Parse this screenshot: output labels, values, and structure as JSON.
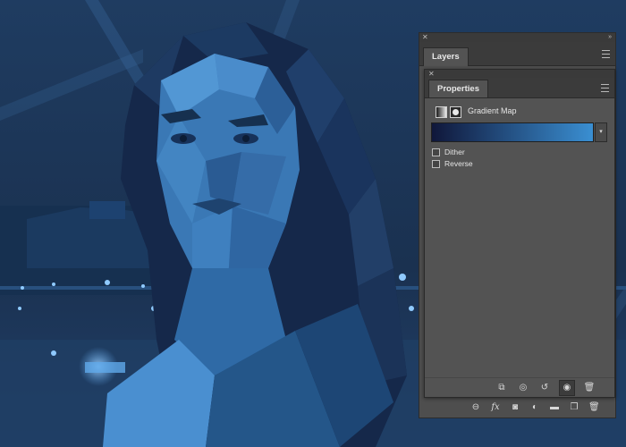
{
  "layers_panel": {
    "tab_label": "Layers",
    "close_icon": "close-x-icon",
    "collapse_icon": "double-chevron-icon",
    "menu_icon": "panel-menu-icon",
    "footer_icons": [
      "link-layers-icon",
      "fx-icon",
      "add-mask-icon",
      "adjustment-layer-icon",
      "group-folder-icon",
      "new-layer-icon",
      "trash-icon"
    ],
    "fx_label": "fx"
  },
  "properties_panel": {
    "tab_label": "Properties",
    "title": "Gradient Map",
    "gradient": {
      "start_color": "#10173a",
      "end_color": "#3a8fd2"
    },
    "options": [
      {
        "label": "Dither",
        "checked": false
      },
      {
        "label": "Reverse",
        "checked": false
      }
    ],
    "footer_icons": [
      "clip-to-layer-icon",
      "view-previous-state-icon",
      "reset-icon",
      "visibility-eye-icon",
      "trash-icon"
    ],
    "visibility_toggle_active": true
  },
  "colors": {
    "canvas_background": "#1b3352",
    "panel_background": "#535353",
    "panel_tab_bar": "#3b3b3b"
  }
}
